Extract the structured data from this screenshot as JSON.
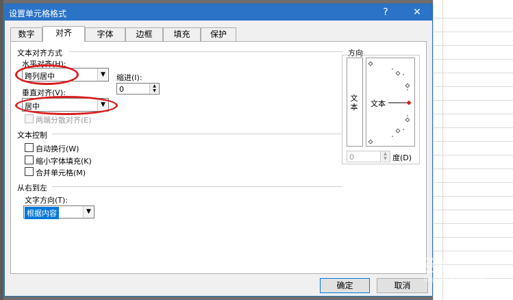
{
  "window": {
    "title": "设置单元格格式",
    "help_label": "?",
    "close_label": "✕"
  },
  "tabs": [
    {
      "label": "数字",
      "active": false
    },
    {
      "label": "对齐",
      "active": true
    },
    {
      "label": "字体",
      "active": false
    },
    {
      "label": "边框",
      "active": false
    },
    {
      "label": "填充",
      "active": false
    },
    {
      "label": "保护",
      "active": false
    }
  ],
  "text_alignment": {
    "group_label": "文本对齐方式",
    "horizontal_label": "水平对齐(H):",
    "horizontal_value": "跨列居中",
    "indent_label": "缩进(I):",
    "indent_value": "0",
    "vertical_label": "垂直对齐(V):",
    "vertical_value": "居中",
    "justify_distributed_label": "两端分散对齐(E)"
  },
  "text_control": {
    "group_label": "文本控制",
    "wrap_text_label": "自动换行(W)",
    "shrink_to_fit_label": "缩小字体填充(K)",
    "merge_cells_label": "合并单元格(M)"
  },
  "rtl": {
    "group_label": "从右到左",
    "direction_label": "文字方向(T):",
    "direction_value": "根据内容"
  },
  "orientation": {
    "group_label": "方向",
    "vertical_text": "文本",
    "dial_text": "文本",
    "degrees_value": "0",
    "degrees_label": "度(D)",
    "marker_color": "#d81e1e"
  },
  "buttons": {
    "ok_label": "确定",
    "cancel_label": "取消"
  },
  "watermark": {
    "text": "Bai 经验",
    "sub": "jingyan.baidu.com"
  }
}
